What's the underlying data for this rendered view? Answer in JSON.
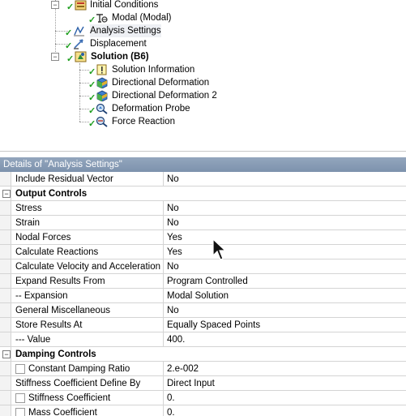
{
  "tree": {
    "items": [
      {
        "label": "Initial Conditions",
        "icon": "initial-conditions-icon",
        "checked": true,
        "expander": "-",
        "bold": false
      },
      {
        "label": "Modal (Modal)",
        "icon": "modal-link-icon",
        "checked": true,
        "bold": false
      },
      {
        "label": "Analysis Settings",
        "icon": "analysis-settings-icon",
        "checked": true,
        "bold": false,
        "selected": true
      },
      {
        "label": "Displacement",
        "icon": "displacement-icon",
        "checked": true,
        "bold": false
      },
      {
        "label": "Solution (B6)",
        "icon": "solution-icon",
        "checked": true,
        "expander": "-",
        "bold": true
      },
      {
        "label": "Solution Information",
        "icon": "solution-information-icon",
        "checked": true,
        "bold": false
      },
      {
        "label": "Directional Deformation",
        "icon": "directional-deformation-icon",
        "checked": true,
        "bold": false
      },
      {
        "label": "Directional Deformation 2",
        "icon": "directional-deformation-icon",
        "checked": true,
        "bold": false
      },
      {
        "label": "Deformation Probe",
        "icon": "deformation-probe-icon",
        "checked": true,
        "bold": false
      },
      {
        "label": "Force Reaction",
        "icon": "force-reaction-icon",
        "checked": true,
        "bold": false
      }
    ]
  },
  "details": {
    "title": "Details of \"Analysis Settings\"",
    "rows": [
      {
        "name": "Include Residual Vector",
        "value": "No"
      },
      {
        "section": "Output Controls",
        "expander": "-"
      },
      {
        "name": "Stress",
        "value": "No"
      },
      {
        "name": "Strain",
        "value": "No"
      },
      {
        "name": "Nodal Forces",
        "value": "Yes"
      },
      {
        "name": "Calculate Reactions",
        "value": "Yes"
      },
      {
        "name": "Calculate Velocity and Acceleration",
        "value": "No"
      },
      {
        "name": "Expand Results From",
        "value": "Program Controlled"
      },
      {
        "name": "-- Expansion",
        "value": "Modal Solution"
      },
      {
        "name": "General Miscellaneous",
        "value": "No"
      },
      {
        "name": "Store Results At",
        "value": "Equally Spaced Points"
      },
      {
        "name": "--- Value",
        "value": "400."
      },
      {
        "section": "Damping Controls",
        "expander": "-"
      },
      {
        "name": "Constant Damping Ratio",
        "value": "2.e-002",
        "checkbox": true
      },
      {
        "name": "Stiffness Coefficient Define By",
        "value": "Direct Input"
      },
      {
        "name": "Stiffness Coefficient",
        "value": "0.",
        "checkbox": true
      },
      {
        "name": "Mass Coefficient",
        "value": "0.",
        "checkbox": true
      }
    ]
  },
  "colors": {
    "header_bg": "#8498b2",
    "check": "#1e9e1e"
  }
}
